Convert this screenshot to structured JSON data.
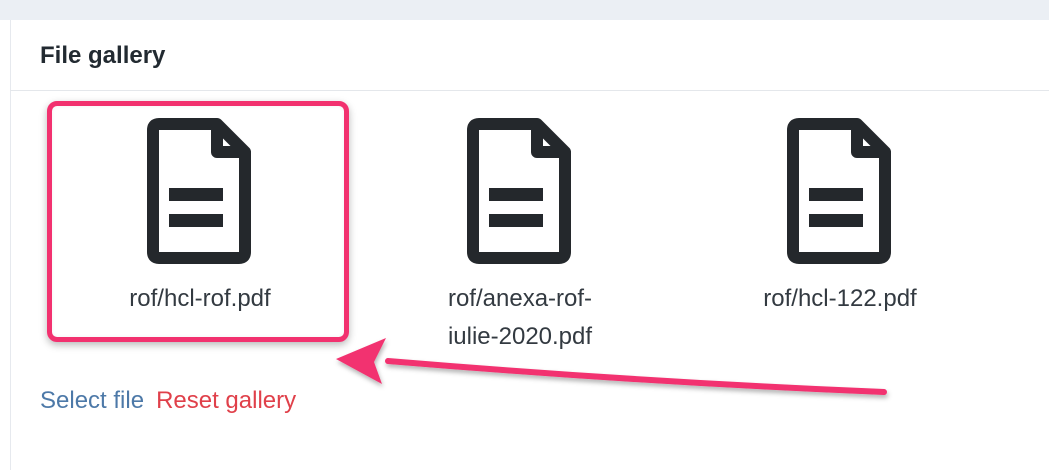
{
  "gallery": {
    "title": "File gallery",
    "files": [
      {
        "name": "rof/hcl-rof.pdf",
        "icon": "document-icon"
      },
      {
        "name": "rof/anexa-rof-iulie-2020.pdf",
        "icon": "document-icon"
      },
      {
        "name": "rof/hcl-122.pdf",
        "icon": "document-icon"
      }
    ],
    "select_label": "Select file",
    "reset_label": "Reset gallery"
  },
  "colors": {
    "highlight": "#f2316f",
    "link_select": "#4d79a8",
    "link_reset": "#e0404a",
    "icon": "#24282c"
  }
}
